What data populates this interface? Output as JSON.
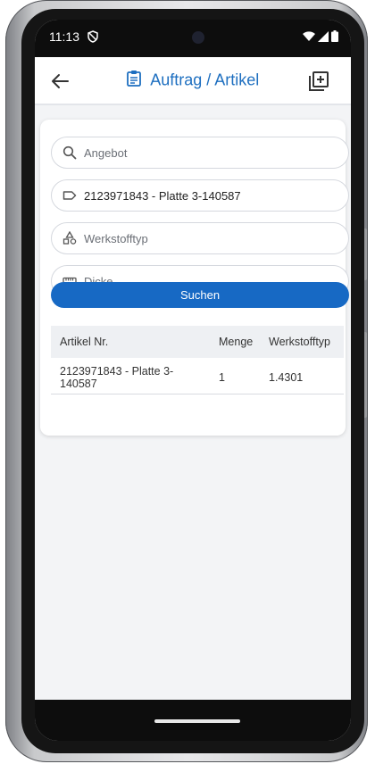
{
  "status_bar": {
    "time": "11:13",
    "vpn_icon": "vpn-key-icon",
    "wifi_icon": "wifi-icon",
    "signal_icon": "signal-icon",
    "battery_icon": "battery-icon"
  },
  "app_bar": {
    "title": "Auftrag / Artikel",
    "back_icon": "arrow-back-icon",
    "title_icon": "clipboard-icon",
    "action_icon": "add-box-icon",
    "accent_color": "#1e6fc0"
  },
  "search_form": {
    "fields": [
      {
        "icon": "search-icon",
        "placeholder": "Angebot",
        "value": ""
      },
      {
        "icon": "label-tag-icon",
        "placeholder": "",
        "value": "2123971843 - Platte 3-140587"
      },
      {
        "icon": "shapes-icon",
        "placeholder": "Werkstofftyp",
        "value": ""
      },
      {
        "icon": "ruler-icon",
        "placeholder": "Dicke",
        "value": ""
      }
    ],
    "submit_label": "Suchen",
    "button_color": "#1769c4"
  },
  "results_table": {
    "headers": [
      "Artikel Nr.",
      "Menge",
      "Werkstofftyp"
    ],
    "rows": [
      [
        "2123971843 - Platte 3-140587",
        "1",
        "1.4301"
      ]
    ]
  },
  "nav_bar": {
    "home_indicator": "home-indicator"
  }
}
